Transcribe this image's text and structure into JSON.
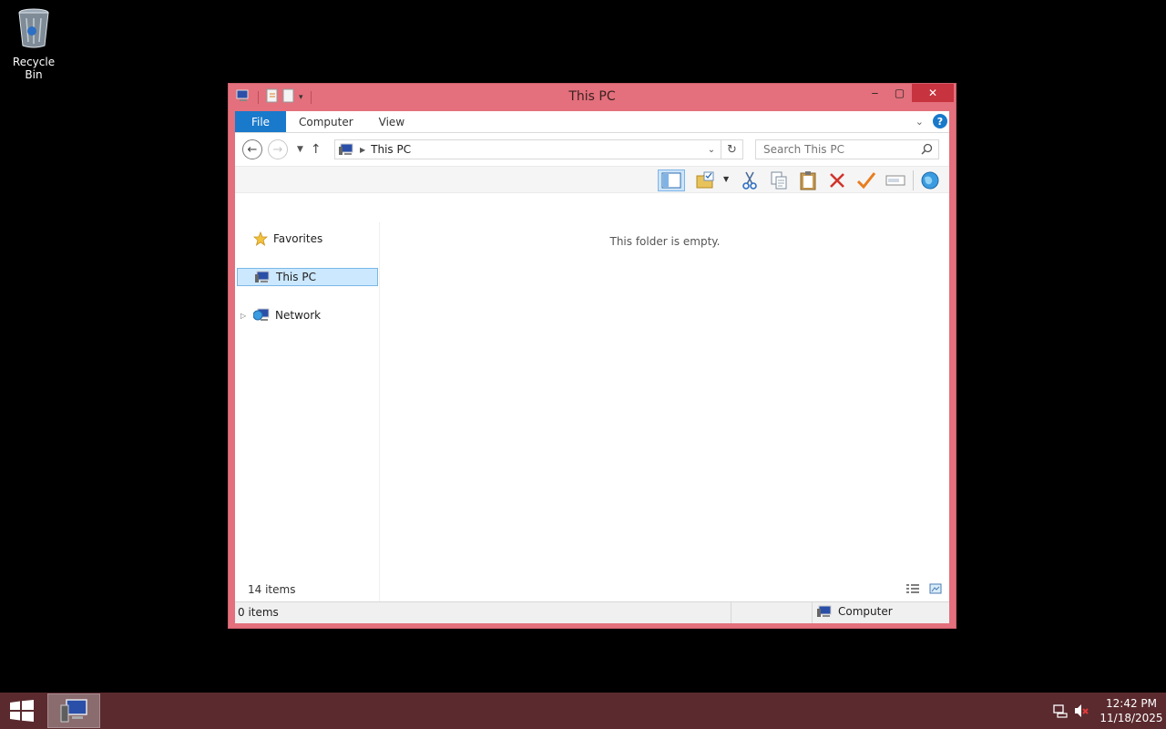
{
  "desktop": {
    "recycle_bin_label": "Recycle Bin"
  },
  "window": {
    "title": "This PC",
    "buttons": {
      "minimize": "‒",
      "maximize": "▢",
      "close": "✕"
    }
  },
  "ribbon": {
    "tabs": [
      "File",
      "Computer",
      "View"
    ],
    "help": "?"
  },
  "navbar": {
    "address_crumb": "This PC",
    "search_placeholder": "Search This PC"
  },
  "nav_pane": {
    "items": [
      "Favorites",
      "This PC",
      "Network"
    ],
    "selected": "This PC"
  },
  "content": {
    "empty_message": "This folder is empty."
  },
  "item_count": "14 items",
  "statusbar": {
    "left": "0 items",
    "zone": "Computer"
  },
  "taskbar": {
    "time": "12:42 PM",
    "date": "11/18/2025"
  },
  "colors": {
    "window_frame": "#e3707c",
    "close_button": "#c7333f",
    "file_tab": "#1979ca",
    "taskbar": "#5a2a2e"
  }
}
